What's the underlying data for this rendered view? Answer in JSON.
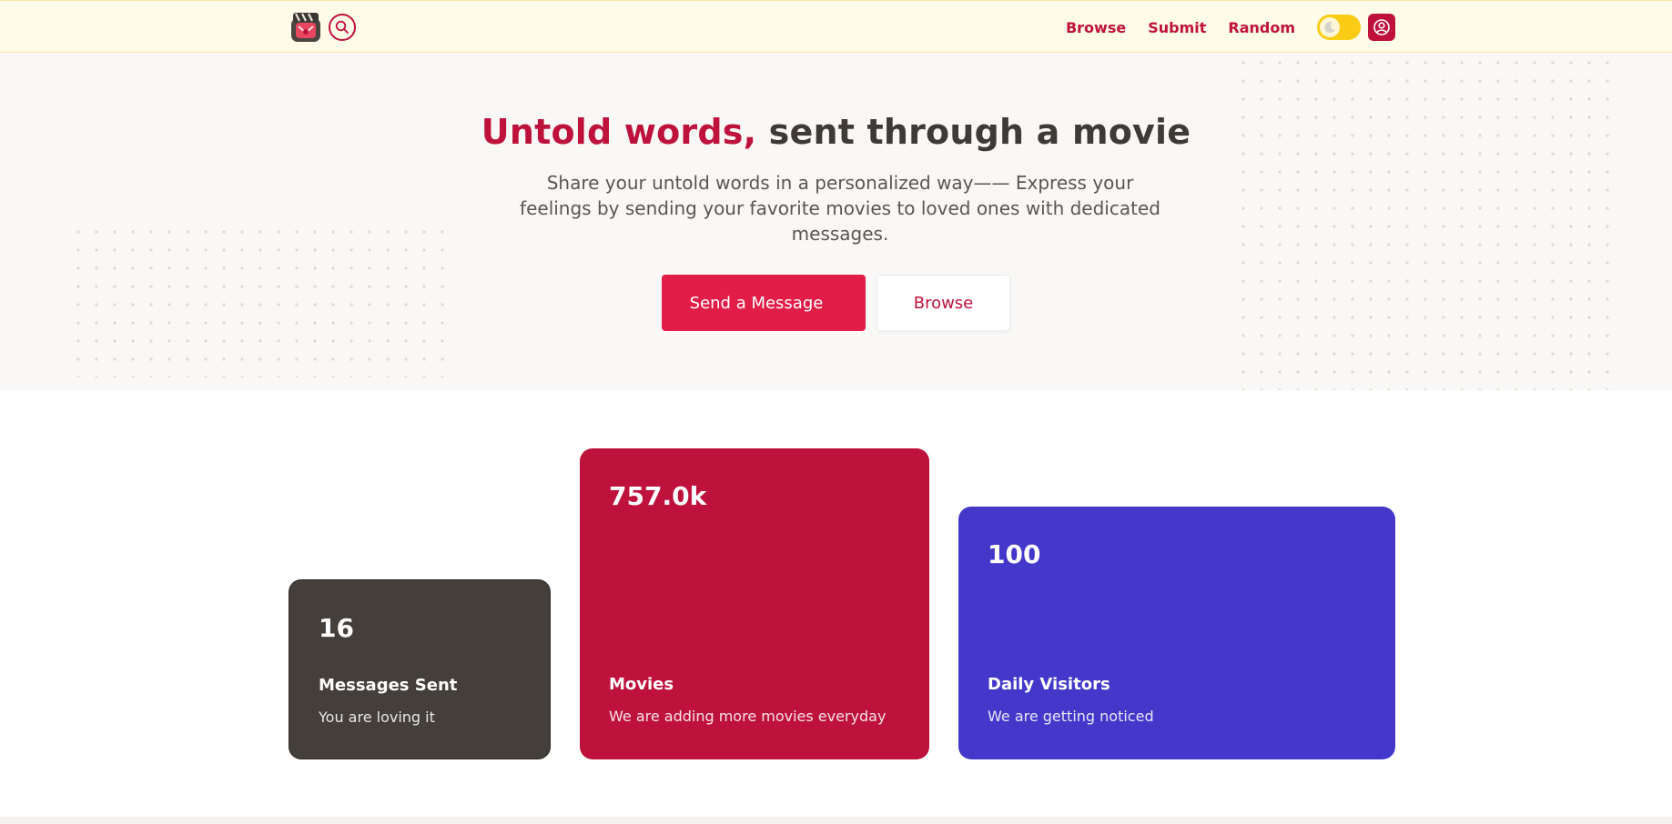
{
  "nav": {
    "links": [
      "Browse",
      "Submit",
      "Random"
    ]
  },
  "icons": {
    "logo": "clapperboard-logo-icon",
    "search": "search-icon",
    "theme": "moon-icon",
    "user": "user-circle-icon"
  },
  "colors": {
    "accent": "#be123c",
    "primary_button": "#e11d48",
    "nav_bg": "#fefbe8",
    "toggle": "#facc15",
    "card_dark": "#443f3a",
    "card_red": "#be123c",
    "card_indigo": "#4338ca"
  },
  "hero": {
    "title_accent": "Untold words,",
    "title_rest": " sent through a movie",
    "subtitle": "Share your untold words in a personalized way—— Express your feelings by sending your favorite movies to loved ones with dedicated messages.",
    "primary_button": "Send a Message",
    "secondary_button": "Browse"
  },
  "stats": [
    {
      "value": "16",
      "label": "Messages Sent",
      "desc": "You are loving it"
    },
    {
      "value": "757.0k",
      "label": "Movies",
      "desc": "We are adding more movies everyday"
    },
    {
      "value": "100",
      "label": "Daily Visitors",
      "desc": "We are getting noticed"
    }
  ]
}
